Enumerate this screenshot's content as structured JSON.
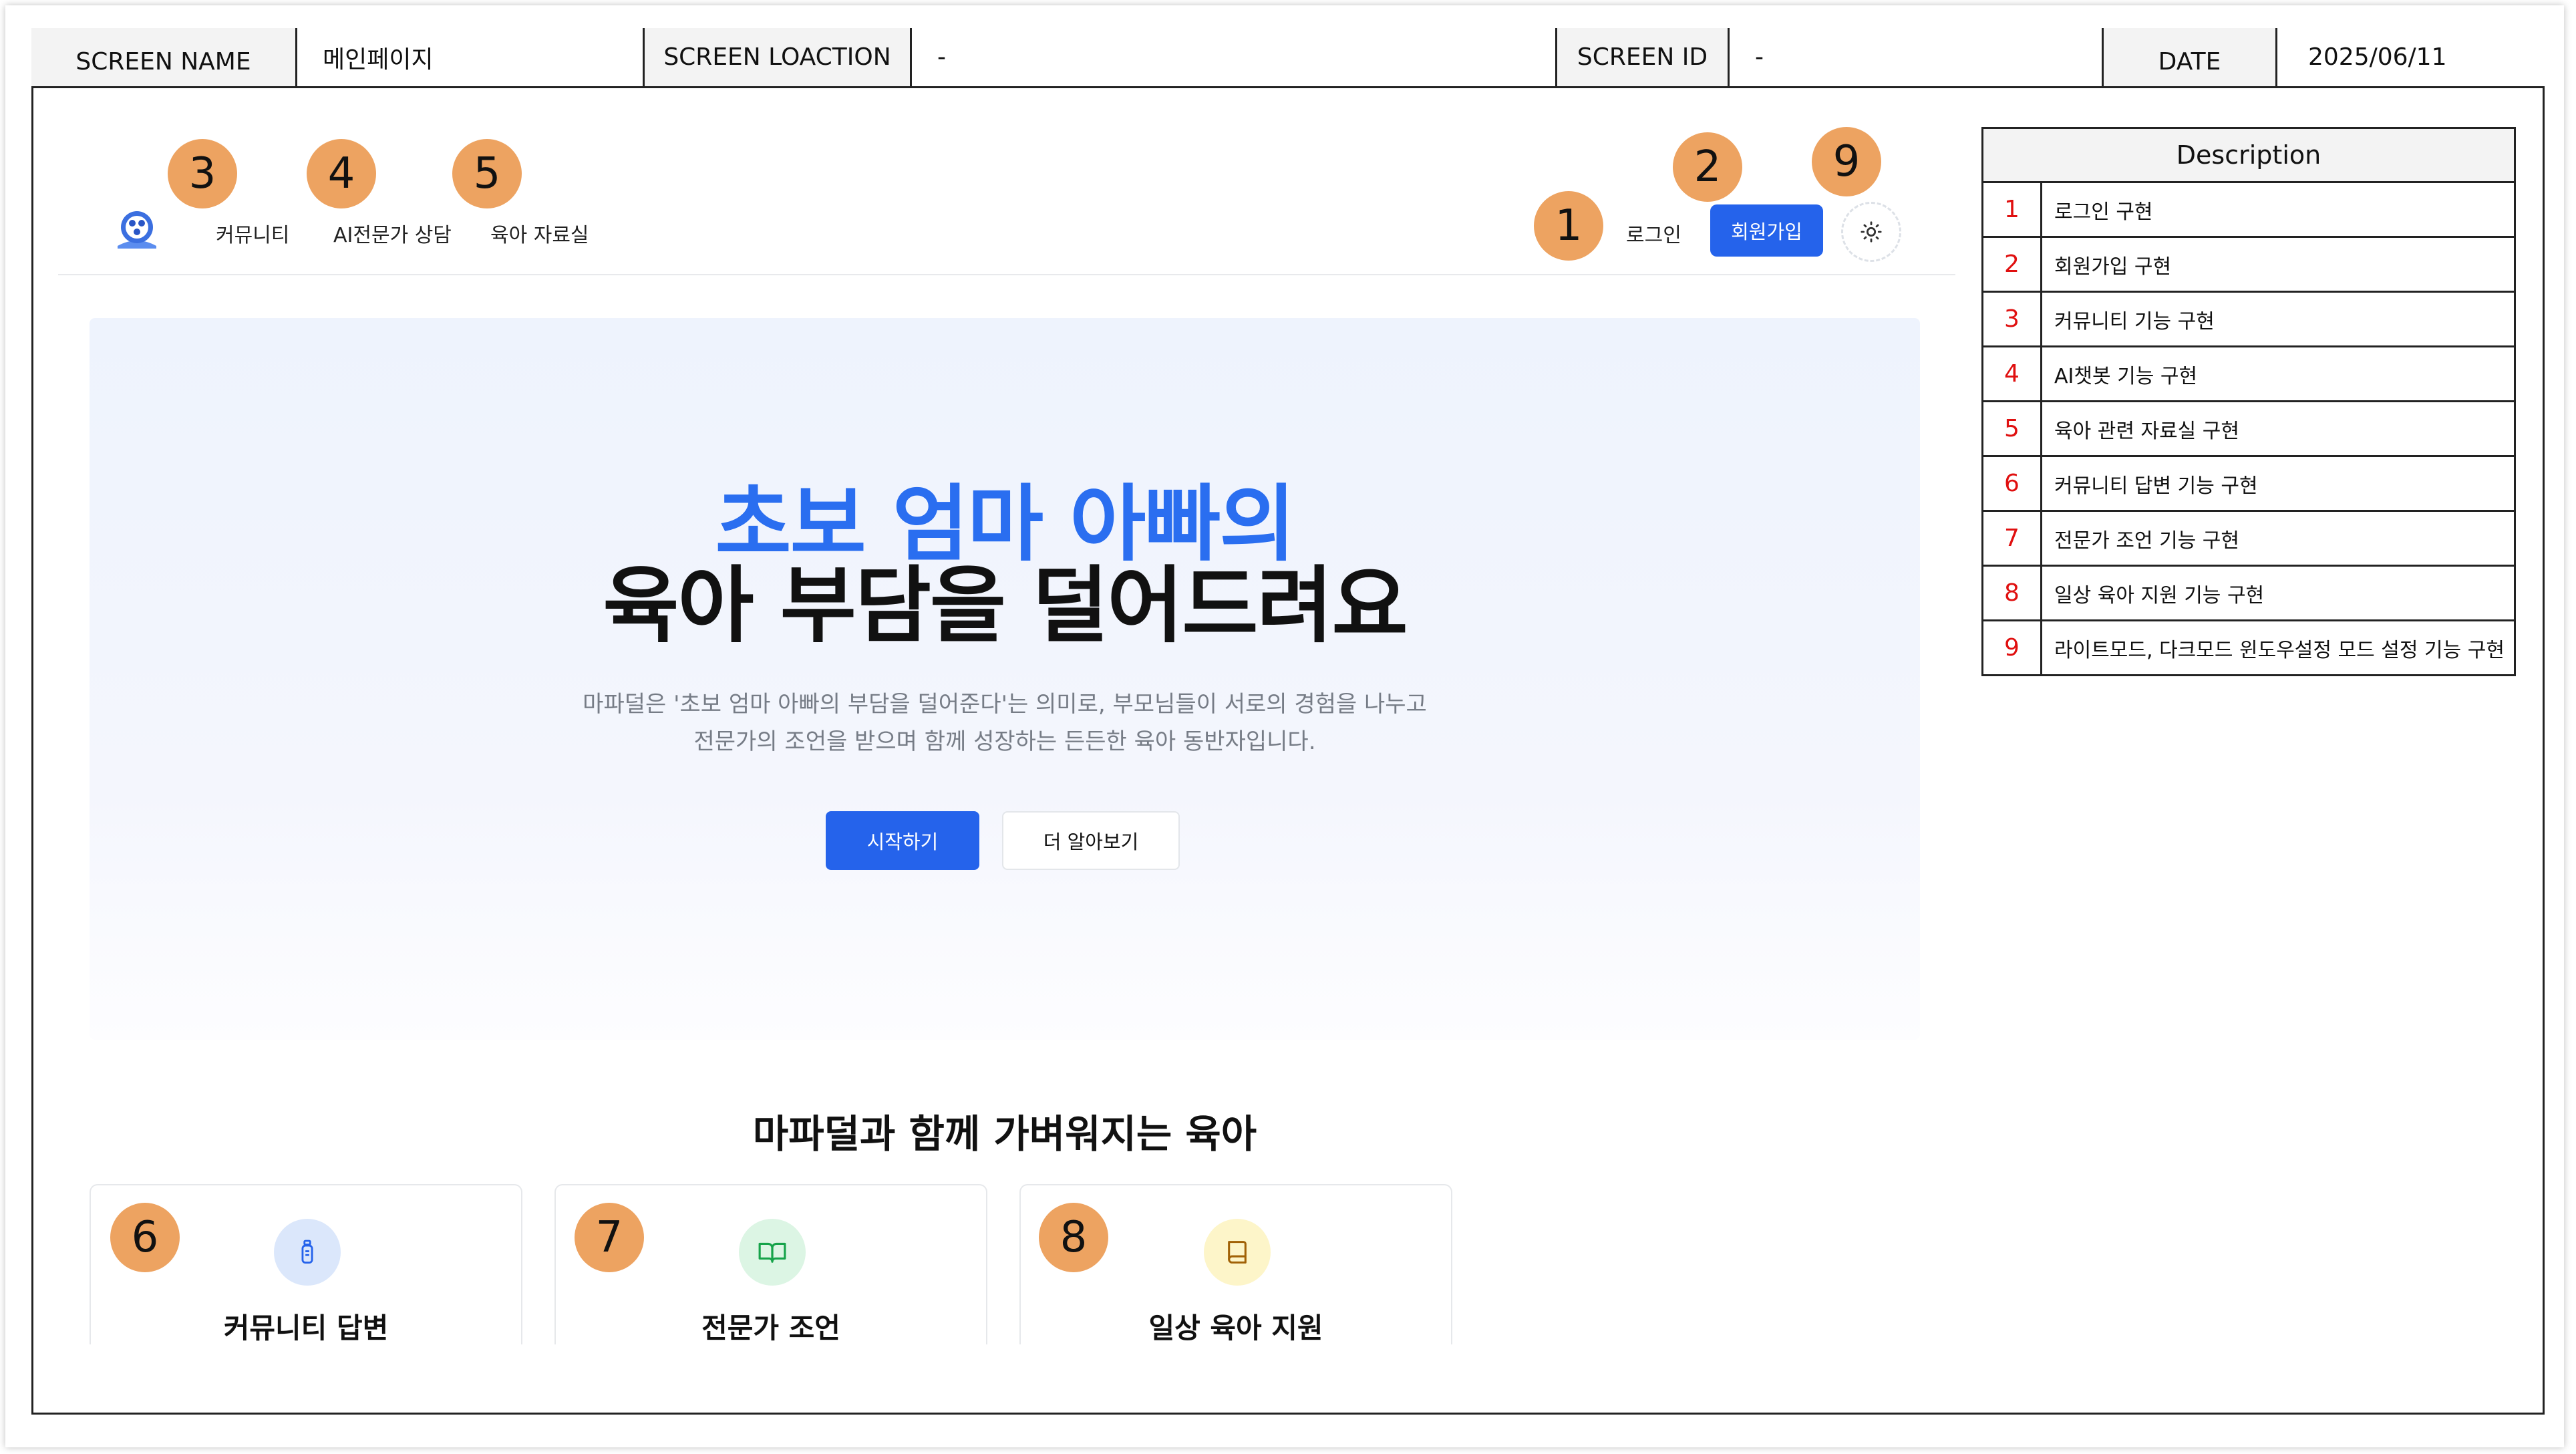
{
  "header": {
    "screen_name_label": "SCREEN NAME",
    "screen_name_value": "메인페이지",
    "screen_location_label": "SCREEN LOACTION",
    "screen_location_value": "-",
    "screen_id_label": "SCREEN ID",
    "screen_id_value": "-",
    "date_label": "DATE",
    "date_value": "2025/06/11"
  },
  "nav": {
    "logo_icon": "globe-face-icon",
    "links": [
      "커뮤니티",
      "AI전문가 상담",
      "육아 자료실"
    ],
    "login": "로그인",
    "signup": "회원가입",
    "theme_icon": "sun-icon"
  },
  "hero": {
    "title_line1": "초보 엄마 아빠의",
    "title_line2": "육아 부담을 덜어드려요",
    "desc_line1": "마파덜은 '초보 엄마 아빠의 부담을 덜어준다'는 의미로, 부모님들이 서로의 경험을 나누고",
    "desc_line2": "전문가의 조언을 받으며 함께 성장하는 든든한 육아 동반자입니다.",
    "start_button": "시작하기",
    "more_button": "더 알아보기"
  },
  "features": {
    "title": "마파덜과 함께 가벼워지는 육아",
    "cards": [
      {
        "title": "커뮤니티 답변",
        "icon": "bottle-icon",
        "icon_bg": "#dbe7fb",
        "icon_color": "#2563eb"
      },
      {
        "title": "전문가 조언",
        "icon": "open-book-icon",
        "icon_bg": "#dcf5e4",
        "icon_color": "#16a34a"
      },
      {
        "title": "일상 육아 지원",
        "icon": "book-icon",
        "icon_bg": "#fdf5c9",
        "icon_color": "#a16207"
      }
    ]
  },
  "markers": [
    "1",
    "2",
    "3",
    "4",
    "5",
    "6",
    "7",
    "8",
    "9"
  ],
  "description": {
    "title": "Description",
    "rows": [
      {
        "num": "1",
        "text": "로그인  구현"
      },
      {
        "num": "2",
        "text": "회원가입 구현"
      },
      {
        "num": "3",
        "text": "커뮤니티 기능 구현"
      },
      {
        "num": "4",
        "text": "AI챗봇 기능 구현"
      },
      {
        "num": "5",
        "text": "육아 관련 자료실 구현"
      },
      {
        "num": "6",
        "text": "커뮤니티 답변 기능 구현"
      },
      {
        "num": "7",
        "text": "전문가 조언 기능 구현"
      },
      {
        "num": "8",
        "text": "일상 육아 지원 기능 구현"
      },
      {
        "num": "9",
        "text": "라이트모드, 다크모드 윈도우설정 모드 설정 기능 구현"
      }
    ]
  },
  "colors": {
    "accent": "#2563eb",
    "hero_title": "#2a6ef0",
    "marker": "#eda361",
    "desc_number": "#e01010"
  }
}
